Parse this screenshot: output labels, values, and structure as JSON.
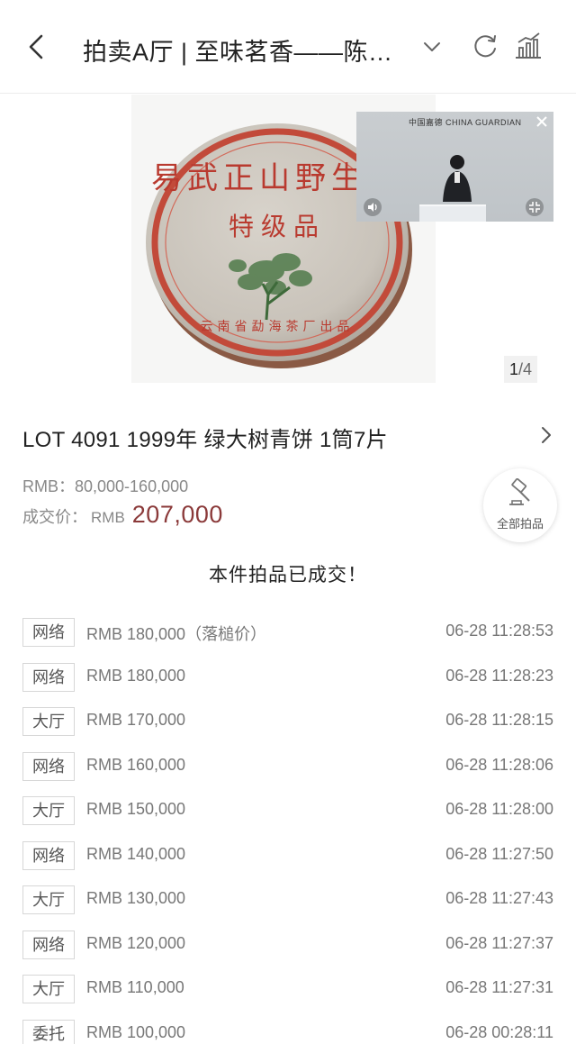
{
  "header": {
    "title": "拍卖A厅 | 至味茗香——陈年…"
  },
  "hero": {
    "image_counter_current": "1",
    "image_counter_total": "/4"
  },
  "video": {
    "logo_text": "中国嘉德 CHINA GUARDIAN"
  },
  "lot": {
    "title": "LOT 4091 1999年  绿大树青饼  1筒7片",
    "estimate": "RMB：80,000-160,000",
    "hammer_label": "成交价：",
    "hammer_currency": "RMB",
    "hammer_price": "207,000",
    "sold_message": "本件拍品已成交！"
  },
  "all_lots": {
    "label": "全部拍品"
  },
  "bids": [
    {
      "channel": "网络",
      "price": "RMB 180,000（落槌价）",
      "time": "06-28 11:28:53"
    },
    {
      "channel": "网络",
      "price": "RMB 180,000",
      "time": "06-28 11:28:23"
    },
    {
      "channel": "大厅",
      "price": "RMB 170,000",
      "time": "06-28 11:28:15"
    },
    {
      "channel": "网络",
      "price": "RMB 160,000",
      "time": "06-28 11:28:06"
    },
    {
      "channel": "大厅",
      "price": "RMB 150,000",
      "time": "06-28 11:28:00"
    },
    {
      "channel": "网络",
      "price": "RMB 140,000",
      "time": "06-28 11:27:50"
    },
    {
      "channel": "大厅",
      "price": "RMB 130,000",
      "time": "06-28 11:27:43"
    },
    {
      "channel": "网络",
      "price": "RMB 120,000",
      "time": "06-28 11:27:37"
    },
    {
      "channel": "大厅",
      "price": "RMB 110,000",
      "time": "06-28 11:27:31"
    },
    {
      "channel": "委托",
      "price": "RMB 100,000",
      "time": "06-28 00:28:11"
    }
  ],
  "colors": {
    "hammer_price": "#8b3a3a",
    "cake_red": "#c0392b",
    "cake_paper": "#cfcac2"
  },
  "icons": {
    "back": "chevron-left-icon",
    "dropdown": "chevron-down-icon",
    "refresh": "refresh-icon",
    "stats": "bar-chart-icon",
    "close": "close-icon",
    "speaker": "speaker-icon",
    "shrink": "shrink-icon",
    "lot_detail": "chevron-right-icon",
    "gavel": "gavel-icon"
  }
}
